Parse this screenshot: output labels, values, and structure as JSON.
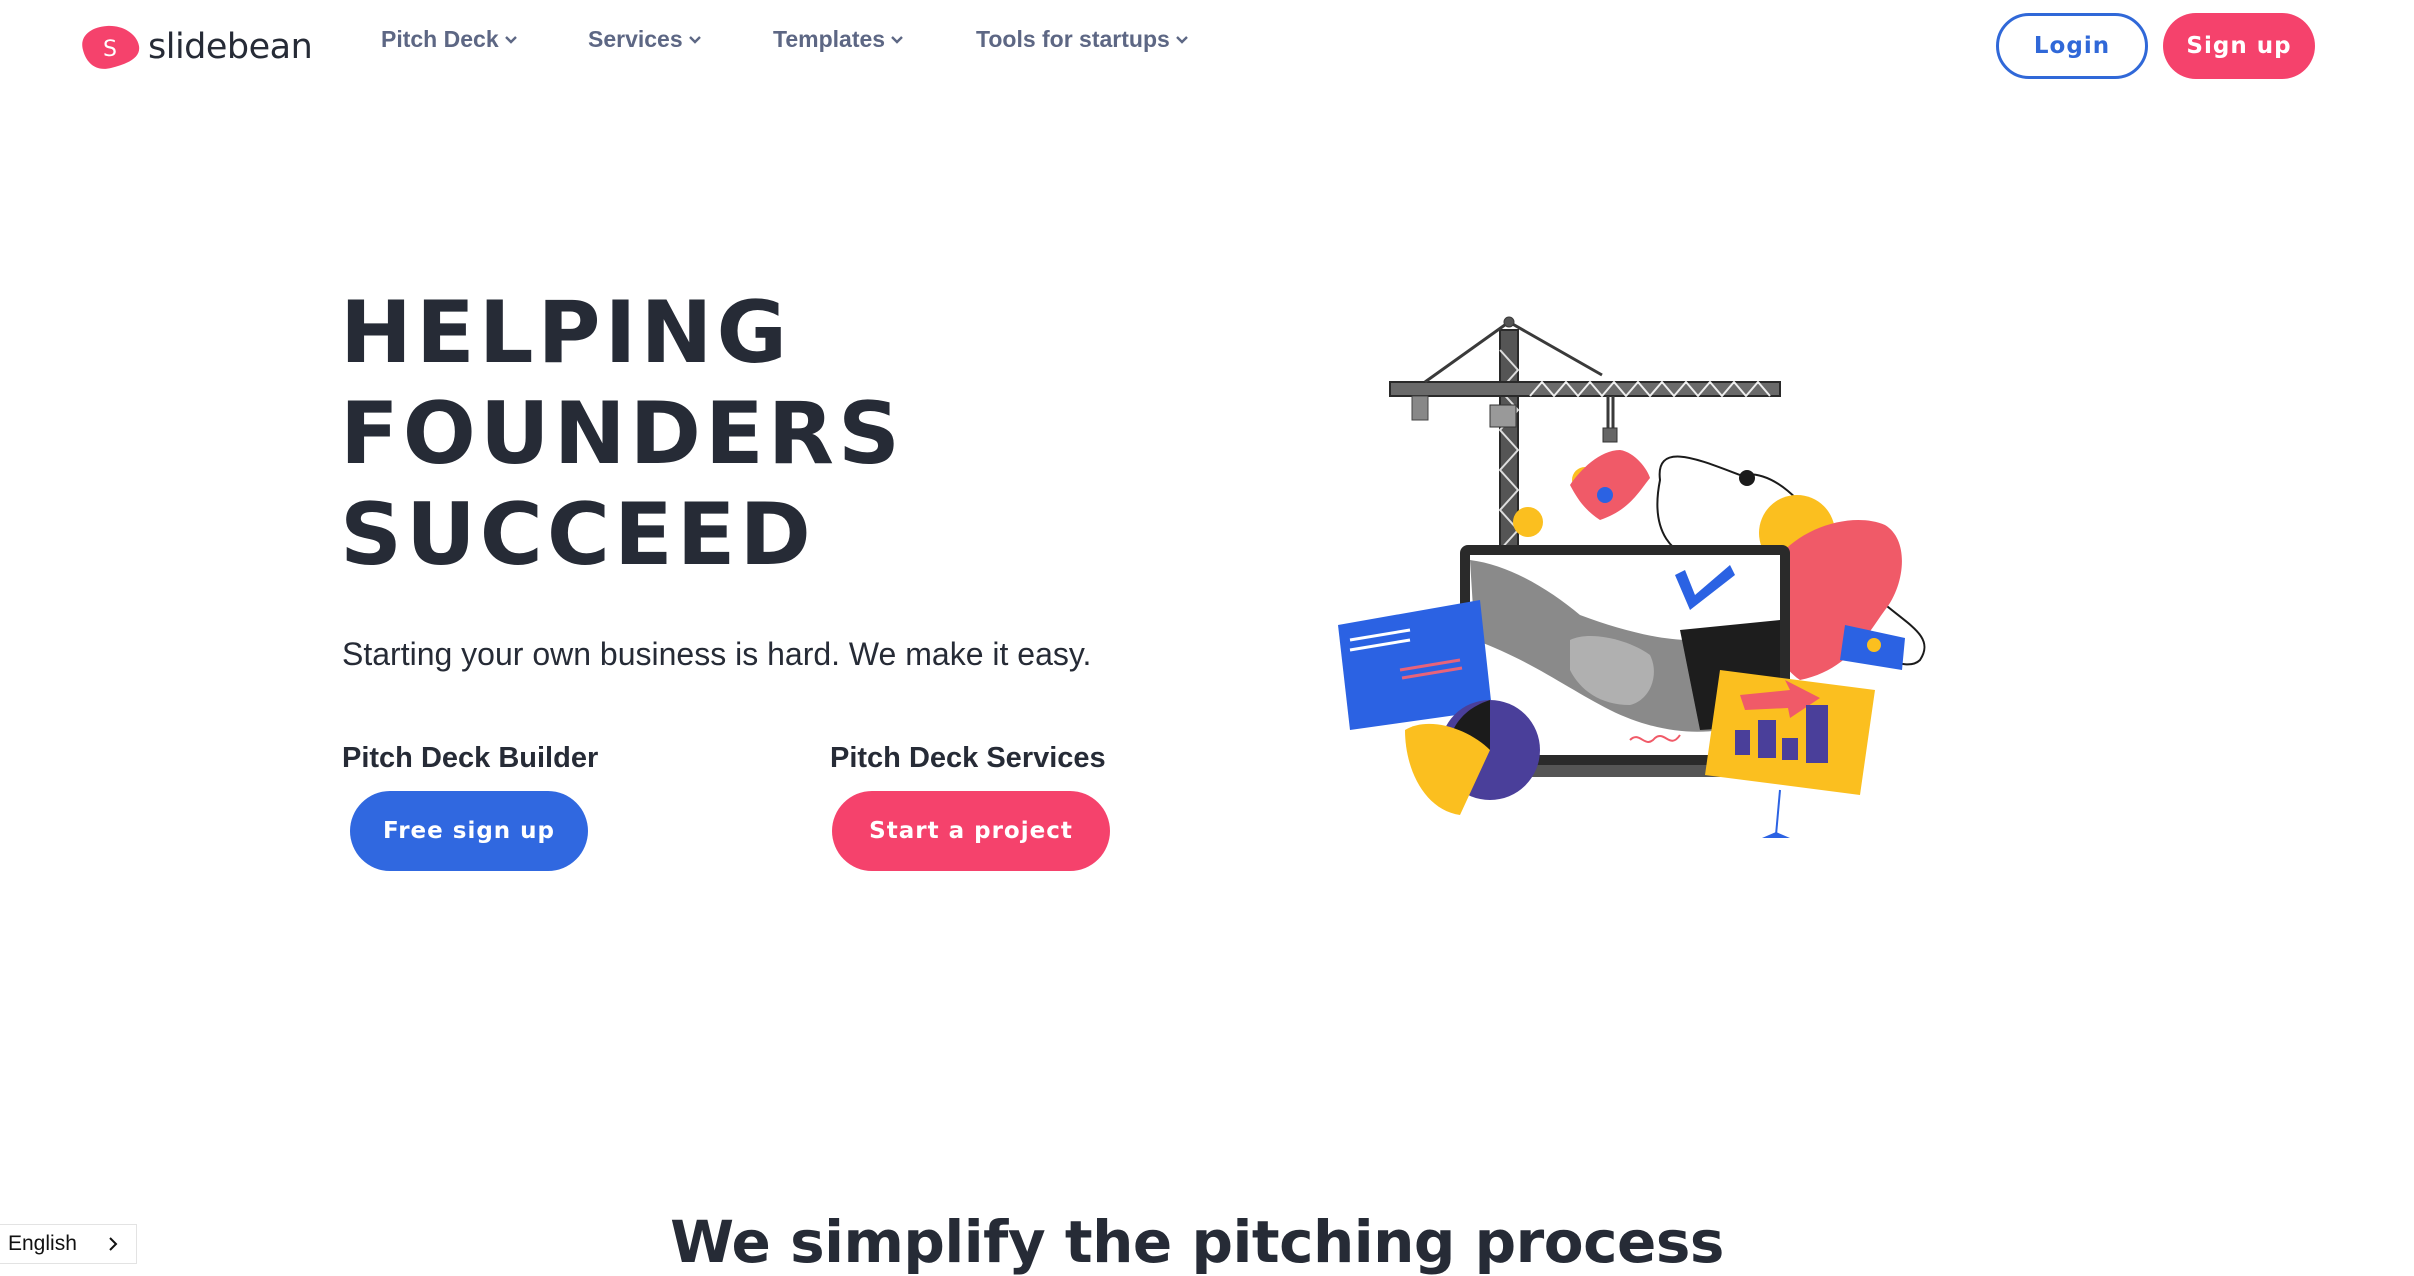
{
  "brand": {
    "name": "slidebean",
    "logo_letter": "S",
    "logo_color": "#f5426c"
  },
  "nav": {
    "items": [
      {
        "label": "Pitch Deck",
        "icon": "chevron-down-icon"
      },
      {
        "label": "Services",
        "icon": "chevron-down-icon"
      },
      {
        "label": "Templates",
        "icon": "chevron-down-icon"
      },
      {
        "label": "Tools for startups",
        "icon": "chevron-down-icon"
      }
    ],
    "login_label": "Login",
    "signup_label": "Sign up"
  },
  "hero": {
    "title_lines": [
      "HELPING",
      "FOUNDERS",
      "SUCCEED"
    ],
    "subtitle": "Starting your own business is hard. We make it easy.",
    "ctas": [
      {
        "label": "Pitch Deck Builder",
        "button": "Free sign up",
        "color": "#3068e0"
      },
      {
        "label": "Pitch Deck Services",
        "button": "Start a project",
        "color": "#f5426c"
      }
    ],
    "illustration": "crane-handshake-laptop-illustration"
  },
  "section": {
    "title": "We simplify the pitching process"
  },
  "language": {
    "selected": "English",
    "icon": "chevron-right-icon"
  },
  "colors": {
    "text_dark": "#262b36",
    "nav_text": "#5d6784",
    "primary_blue": "#3068e0",
    "primary_pink": "#f5426c",
    "accent_yellow": "#fbbf1f",
    "accent_purple": "#4a3f9a"
  }
}
